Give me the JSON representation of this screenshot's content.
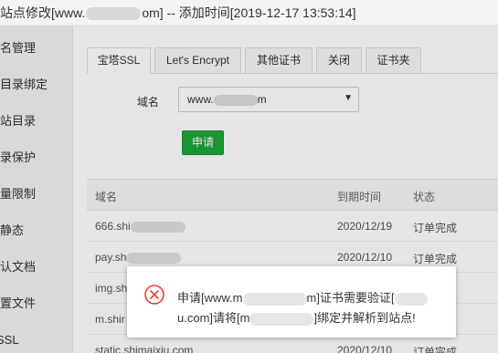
{
  "titlebar": {
    "title_prefix": "站点修改[www.",
    "title_mid": "om] -- 添加时间[2019-12-17 13:53:14]"
  },
  "sidebar": {
    "items": [
      {
        "label": "域名管理"
      },
      {
        "label": "子目录绑定"
      },
      {
        "label": "网站目录"
      },
      {
        "label": "目录保护"
      },
      {
        "label": "流量限制"
      },
      {
        "label": "伪静态"
      },
      {
        "label": "默认文档"
      },
      {
        "label": "配置文件"
      },
      {
        "label": "SSL"
      }
    ]
  },
  "tabs": [
    {
      "label": "宝塔SSL",
      "active": true
    },
    {
      "label": "Let's Encrypt",
      "active": false
    },
    {
      "label": "其他证书",
      "active": false
    },
    {
      "label": "关闭",
      "active": false
    },
    {
      "label": "证书夹",
      "active": false
    }
  ],
  "form": {
    "domain_label": "域名",
    "domain_value_prefix": "www.",
    "domain_value_suffix": "m",
    "apply_label": "申请"
  },
  "table": {
    "headers": {
      "domain": "域名",
      "expiry": "到期时间",
      "status": "状态"
    },
    "rows": [
      {
        "domain": "666.shi",
        "expiry": "2020/12/19",
        "status": "订单完成"
      },
      {
        "domain": "pay.sh",
        "expiry": "2020/12/10",
        "status": "订单完成"
      },
      {
        "domain": "img.sh",
        "expiry": "",
        "status": ""
      },
      {
        "domain": "m.shir",
        "expiry": "",
        "status": ""
      },
      {
        "domain": "static.shimaixiu.com",
        "expiry": "2020/12/10",
        "status": "订单完成"
      }
    ]
  },
  "toast": {
    "line1_prefix": "申请[www.m",
    "line1_suffix": "m]证书需要验证[",
    "line2_prefix": "u.com]请将[m",
    "line2_suffix": "]绑定并解析到站点!",
    "icon": "error-circle-icon",
    "icon_color": "#e8412e"
  },
  "colors": {
    "accent_green": "#20a53a"
  }
}
